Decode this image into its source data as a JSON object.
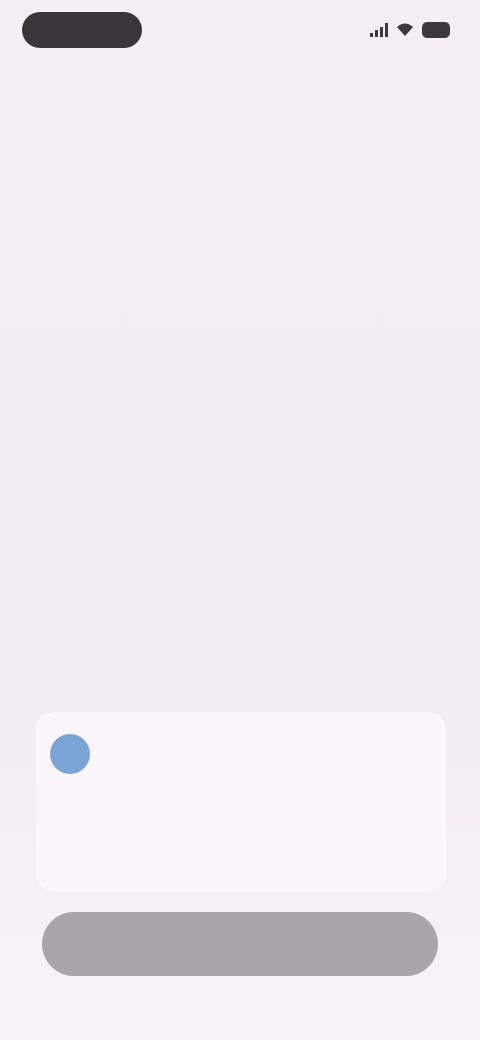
{
  "status_bar": {
    "time": "",
    "icons": [
      "signal-icon",
      "wifi-icon",
      "battery-icon"
    ]
  },
  "header": {
    "title": "",
    "subtitle": ""
  },
  "otp_card": {
    "account_initial": "",
    "account_email": "",
    "digits": [
      "",
      "",
      "",
      "",
      "",
      ""
    ]
  },
  "primary_button": {
    "label": ""
  },
  "colors": {
    "background": "#f6f0f6",
    "card": "#fbf6fb",
    "avatar": "#7aa3d6",
    "button_disabled": "#a9a5ab"
  }
}
